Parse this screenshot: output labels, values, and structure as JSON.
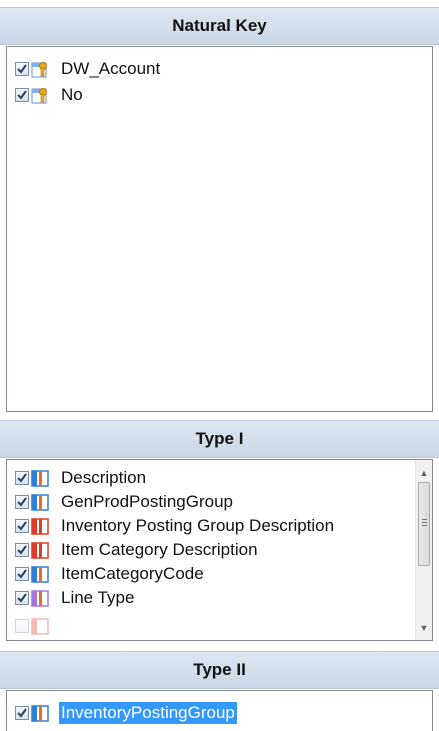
{
  "natural_key": {
    "title": "Natural Key",
    "items": [
      {
        "label": "DW_Account",
        "icon": "key-table-icon",
        "checked": true
      },
      {
        "label": "No",
        "icon": "key-table-icon",
        "checked": true
      }
    ]
  },
  "type1": {
    "title": "Type I",
    "items": [
      {
        "label": "Description",
        "icon": "column-blue-icon",
        "checked": true
      },
      {
        "label": "GenProdPostingGroup",
        "icon": "column-blue-icon",
        "checked": true
      },
      {
        "label": "Inventory Posting Group Description",
        "icon": "column-red-icon",
        "checked": true
      },
      {
        "label": "Item Category Description",
        "icon": "column-red-icon",
        "checked": true
      },
      {
        "label": "ItemCategoryCode",
        "icon": "column-blue-icon",
        "checked": true
      },
      {
        "label": "Line Type",
        "icon": "column-purple-icon",
        "checked": true
      }
    ]
  },
  "type2": {
    "title": "Type II",
    "items": [
      {
        "label": "InventoryPostingGroup",
        "icon": "column-blue-icon",
        "checked": true,
        "selected": true
      }
    ]
  },
  "colors": {
    "header_bg": "#cbd7e6",
    "selection": "#3399ff",
    "blue_column": "#2f7fd6",
    "red_column": "#e03a2a",
    "purple_column": "#a678d8",
    "key_gold": "#f2a81d"
  }
}
